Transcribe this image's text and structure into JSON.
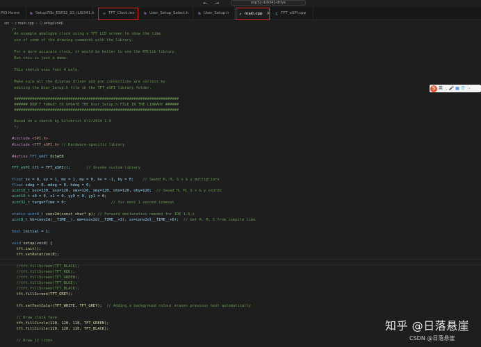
{
  "titlebar": {
    "back": "←",
    "forward": "→",
    "search_text": "esp32-ILI9341-drive"
  },
  "tabs": [
    {
      "label": "PIO Home",
      "icon_color": "#e37933"
    },
    {
      "label": "Setup70b_ESP32_S3_ILI9341.h",
      "icon_color": "#a074c4"
    },
    {
      "label": "TFT_Clock.ino",
      "icon_color": "#519aba"
    },
    {
      "label": "User_Setup_Select.h",
      "icon_color": "#a074c4"
    },
    {
      "label": "User_Setup.h",
      "icon_color": "#a074c4"
    },
    {
      "label": "main.cpp",
      "icon_color": "#519aba",
      "close": "×"
    },
    {
      "label": "TFT_eSPI.cpp",
      "icon_color": "#519aba"
    }
  ],
  "breadcrumb": {
    "folder": "src",
    "file": "main.cpp",
    "symbol": "setup(void)"
  },
  "code": {
    "l01": "/*",
    "l02": " An example analogue clock using a TFT LCD screen to show the time",
    "l03": " use of some of the drawing commands with the library.",
    "l04": " For a more accurate clock, it would be better to use the RTClib library.",
    "l05": " But this is just a demo.",
    "l06": " This sketch uses font 4 only.",
    "l07": " Make sure all the display driver and pin connections are correct by",
    "l08": " editing the User_Setup.h file in the TFT_eSPI library folder.",
    "l09": " #########################################################################",
    "l10": " ###### DON'T FORGET TO UPDATE THE User_Setup.h FILE IN THE LIBRARY ######",
    "l11": " #########################################################################",
    "l12": " Based on a sketch by Gilchrist 6/2/2014 1.0",
    "l13": " */",
    "l14_a": "#include ",
    "l14_b": "<SPI.h>",
    "l15_a": "#include ",
    "l15_b": "<TFT_eSPI.h>",
    "l15_c": " // Hardware-specific library",
    "l16_a": "#define ",
    "l16_b": "TFT_GREY ",
    "l16_c": "0x5AEB",
    "l17_a": "TFT_eSPI ",
    "l17_b": "tft = TFT_eSPI();",
    "l17_c": "       // Invoke custom library",
    "l18_a": "float ",
    "l18_b": "sx = 0, sy = 1, mx = 1, my = 0, hx = -1, hy = 0;",
    "l18_c": "    // Saved H, M, S x & y multipliers",
    "l19_a": "float ",
    "l19_b": "sdeg = 0, mdeg = 0, hdeg = 0;",
    "l20_a": "uint16_t ",
    "l20_b": "osx=120, osy=120, omx=120, omy=120, ohx=120, ohy=120;",
    "l20_c": "  // Saved H, M, S x & y coords",
    "l21_a": "uint16_t ",
    "l21_b": "x0 = 0, x1 = 0, yy0 = 0, yy1 = 0;",
    "l22_a": "uint32_t ",
    "l22_b": "targetTime = 0;",
    "l22_c": "                    // for next 1 second timeout",
    "l23_a": "static uint8_t ",
    "l23_b": "conv2d(const char* p);",
    "l23_c": " // Forward declaration needed for IDE 1.6.x",
    "l24_a": "uint8_t ",
    "l24_b": "hh=conv2d(__TIME__), mm=conv2d(__TIME__+3), ss=conv2d(__TIME__+6);",
    "l24_c": "  // Get H, M, S from compile time",
    "l25_a": "bool ",
    "l25_b": "initial = 1;",
    "l26_a": "void ",
    "l26_b": "setup",
    "l26_c": "(void) {",
    "l27": "  tft.init();",
    "l28": "  tft.setRotation(0);",
    "l29": "  //tft.fillScreen(TFT_BLACK);",
    "l30": "  //tft.fillScreen(TFT_RED);",
    "l31": "  //tft.fillScreen(TFT_GREEN);",
    "l32": "  //tft.fillScreen(TFT_BLUE);",
    "l33": "  //tft.fillScreen(TFT_BLACK);",
    "l34": "  tft.fillScreen(TFT_GREY);",
    "l35_a": "  tft.setTextColor(TFT_WHITE, TFT_GREY);",
    "l35_b": "  // Adding a background colour erases previous text automatically",
    "l36": "  // Draw clock face",
    "l37": "  tft.fillCircle(120, 120, 118, TFT_GREEN);",
    "l38": "  tft.fillCircle(120, 120, 110, TFT_BLACK);",
    "l39": "  // Draw 12 lines"
  },
  "translate_bar": {
    "logo": "S",
    "lang": "英",
    "icons": "·, 🎤 ▦ 👕 ⋯"
  },
  "watermark": {
    "main": "知乎 @日落悬崖",
    "sub": "CSDN @日落悬崖"
  },
  "colors": {
    "highlight_box": "#e01f26",
    "editor_bg": "#1e1e1e",
    "comment": "#6a9955",
    "keyword": "#569cd6"
  }
}
